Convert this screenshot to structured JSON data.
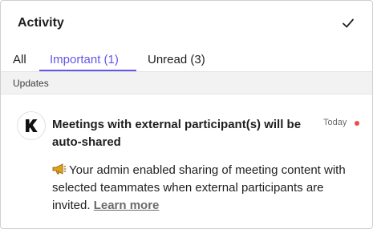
{
  "header": {
    "title": "Activity",
    "mark_all_read_icon": "checkmark-icon"
  },
  "tabs": [
    {
      "label": "All",
      "active": false
    },
    {
      "label": "Important (1)",
      "active": true
    },
    {
      "label": "Unread (3)",
      "active": false
    }
  ],
  "section": {
    "label": "Updates"
  },
  "notification": {
    "avatar_icon": "k-logo-icon",
    "title": "Meetings with external participant(s) will be auto-shared",
    "timestamp": "Today",
    "unread": true,
    "body_icon": "megaphone-icon",
    "body": "Your admin enabled sharing of meeting content with selected teammates when external participants are invited.",
    "link_label": "Learn more"
  },
  "colors": {
    "accent": "#6357e8",
    "unread_dot": "#ef4a4a",
    "section_bg": "#f2f2f2"
  }
}
